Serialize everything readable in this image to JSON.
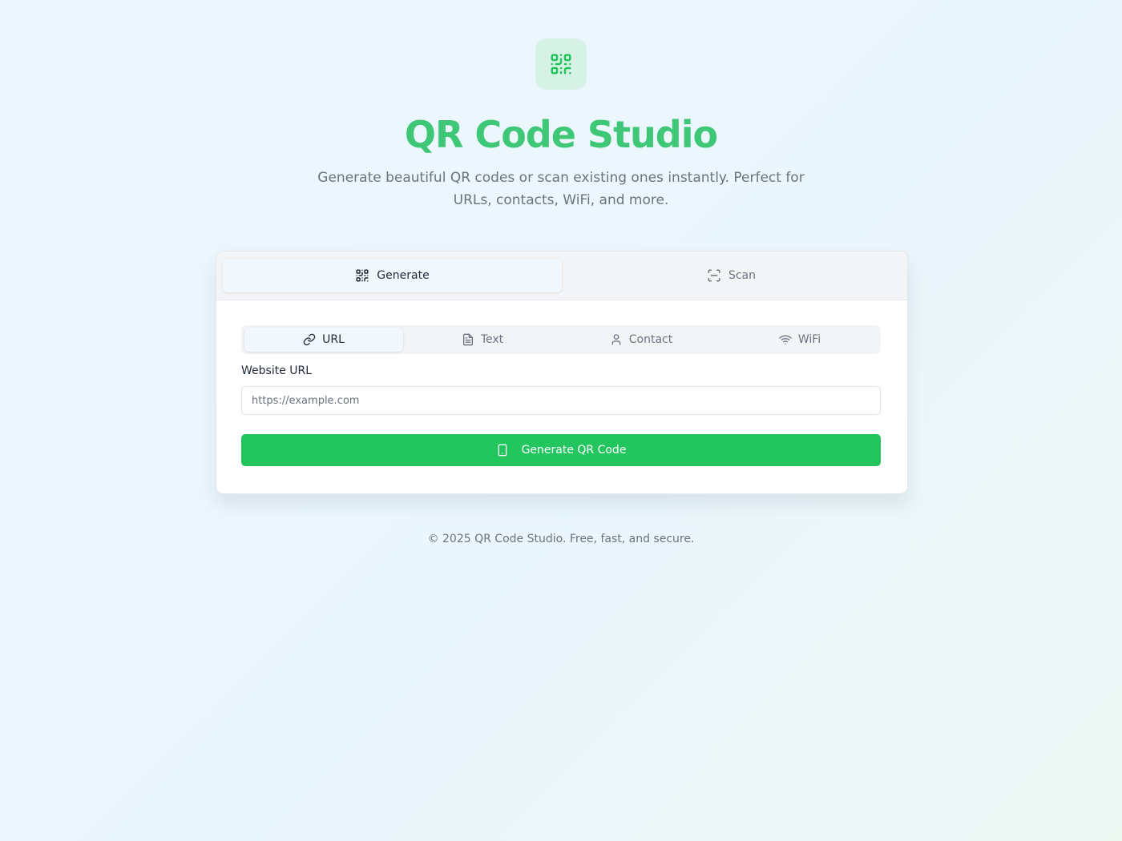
{
  "hero": {
    "icon": "qr-code-icon",
    "title": "QR Code Studio",
    "subtitle": "Generate beautiful QR codes or scan existing ones instantly. Perfect for URLs, contacts, WiFi, and more."
  },
  "main_tabs": [
    {
      "label": "Generate",
      "icon": "qr-code-icon",
      "active": true
    },
    {
      "label": "Scan",
      "icon": "scan-icon",
      "active": false
    }
  ],
  "sub_tabs": [
    {
      "label": "URL",
      "icon": "link-icon",
      "active": true
    },
    {
      "label": "Text",
      "icon": "file-text-icon",
      "active": false
    },
    {
      "label": "Contact",
      "icon": "user-icon",
      "active": false
    },
    {
      "label": "WiFi",
      "icon": "wifi-icon",
      "active": false
    }
  ],
  "form": {
    "label": "Website URL",
    "placeholder": "https://example.com",
    "value": "",
    "button_label": "Generate QR Code",
    "button_icon": "smartphone-icon"
  },
  "footer": {
    "text": "© 2025 QR Code Studio. Free, fast, and secure."
  },
  "colors": {
    "accent": "#22c55e",
    "title": "#3ec777",
    "icon_bg": "#d6f2e5"
  }
}
